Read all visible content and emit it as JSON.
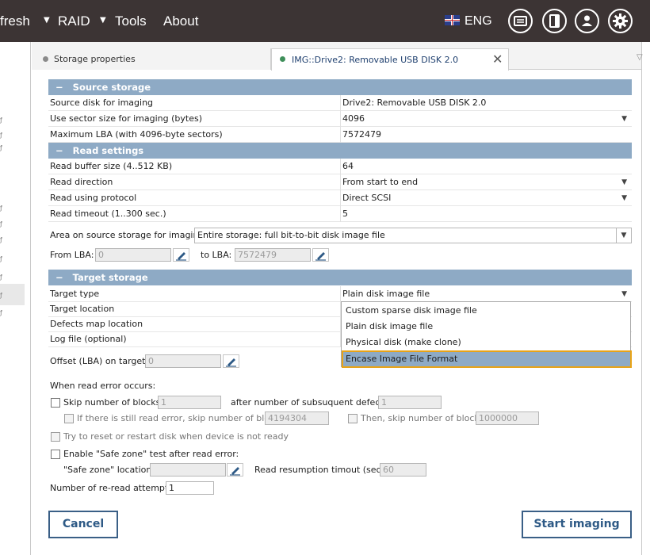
{
  "topbar": {
    "menu": [
      "fresh",
      "RAID",
      "Tools",
      "About"
    ],
    "language": "ENG",
    "icons": [
      "monitor-icon",
      "panel-icon",
      "user-icon",
      "gear-icon"
    ]
  },
  "tabs": [
    {
      "label": "Storage properties",
      "active": false
    },
    {
      "label": "IMG::Drive2: Removable USB DISK 2.0",
      "active": true
    }
  ],
  "source": {
    "title": "Source storage",
    "rows": [
      {
        "key": "Source disk for imaging",
        "value": "Drive2: Removable USB DISK 2.0",
        "dropdown": false
      },
      {
        "key": "Use sector size for imaging (bytes)",
        "value": "4096",
        "dropdown": true
      },
      {
        "key": "Maximum LBA (with 4096-byte sectors)",
        "value": "7572479",
        "dropdown": false
      }
    ]
  },
  "read": {
    "title": "Read settings",
    "rows": [
      {
        "key": "Read buffer size (4..512 KB)",
        "value": "64",
        "dropdown": false
      },
      {
        "key": "Read direction",
        "value": "From start to end",
        "dropdown": true
      },
      {
        "key": "Read using protocol",
        "value": "Direct SCSI",
        "dropdown": true
      },
      {
        "key": "Read timeout (1..300 sec.)",
        "value": "5",
        "dropdown": false
      }
    ]
  },
  "area": {
    "label": "Area on source storage for imaging:",
    "value": "Entire storage: full bit-to-bit disk image file",
    "from_label": "From LBA:",
    "from_value": "0",
    "to_label": "to LBA:",
    "to_value": "7572479"
  },
  "target": {
    "title": "Target storage",
    "rows": [
      {
        "key": "Target type",
        "value": "Plain disk image file",
        "dropdown": true
      },
      {
        "key": "Target location",
        "value": "",
        "dropdown": false
      },
      {
        "key": "Defects map location",
        "value": "",
        "dropdown": false
      },
      {
        "key": "Log file (optional)",
        "value": "",
        "dropdown": false
      }
    ],
    "offset_label": "Offset (LBA) on target:",
    "offset_value": "0"
  },
  "dropdown_options": [
    "Custom sparse disk image file",
    "Plain disk image file",
    "Physical disk (make clone)",
    "Encase Image File Format"
  ],
  "errors": {
    "heading": "When read error occurs:",
    "skip_label": "Skip number of blocks:",
    "skip_value": "1",
    "after_label": "after number of subsuquent defects:",
    "after_value": "1",
    "still_label": "If there is still read error, skip number of blocks:",
    "still_value": "4194304",
    "then_label": "Then, skip number of blocks:",
    "then_value": "1000000",
    "reset_label": "Try to reset or restart disk when device is not ready",
    "safe_label": "Enable \"Safe zone\" test after read error:",
    "safe_loc_label": "\"Safe zone\" location:",
    "safe_loc_value": "",
    "resume_label": "Read resumption timout (sec.):",
    "resume_value": "60",
    "reread_label": "Number of re-read attempts:",
    "reread_value": "1"
  },
  "buttons": {
    "cancel": "Cancel",
    "start": "Start imaging"
  },
  "colors": {
    "topbar": "#3c3434",
    "section": "#8eaac5",
    "accent_button": "#2e5a86",
    "highlight_border": "#e8a317"
  }
}
